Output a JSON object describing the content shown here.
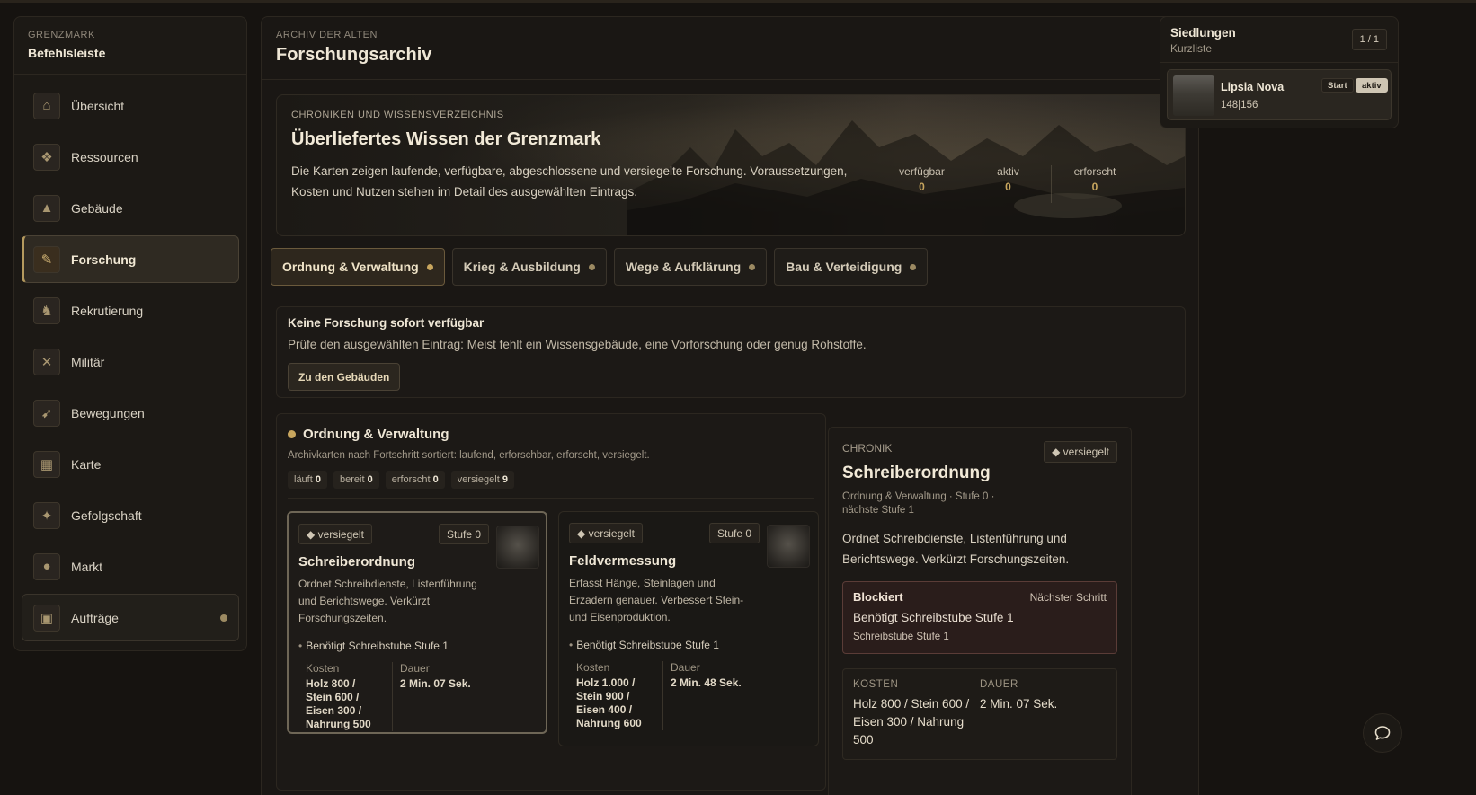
{
  "sidebar": {
    "eyebrow": "GRENZMARK",
    "title": "Befehlsleiste",
    "items": [
      {
        "label": "Übersicht",
        "icon": "overview-icon"
      },
      {
        "label": "Ressourcen",
        "icon": "resources-icon"
      },
      {
        "label": "Gebäude",
        "icon": "buildings-icon"
      },
      {
        "label": "Forschung",
        "icon": "research-icon"
      },
      {
        "label": "Rekrutierung",
        "icon": "recruitment-icon"
      },
      {
        "label": "Militär",
        "icon": "military-icon"
      },
      {
        "label": "Bewegungen",
        "icon": "movements-icon"
      },
      {
        "label": "Karte",
        "icon": "map-icon"
      },
      {
        "label": "Gefolgschaft",
        "icon": "following-icon"
      },
      {
        "label": "Markt",
        "icon": "market-icon"
      },
      {
        "label": "Aufträge",
        "icon": "orders-icon"
      }
    ]
  },
  "header": {
    "eyebrow": "ARCHIV DER ALTEN",
    "title": "Forschungsarchiv"
  },
  "hero": {
    "eyebrow": "CHRONIKEN UND WISSENSVERZEICHNIS",
    "title": "Überliefertes Wissen der Grenzmark",
    "description": "Die Karten zeigen laufende, verfügbare, abgeschlossene und versiegelte Forschung. Voraussetzungen, Kosten und Nutzen stehen im Detail des ausgewählten Eintrags.",
    "stats": [
      {
        "label": "verfügbar",
        "value": "0"
      },
      {
        "label": "aktiv",
        "value": "0"
      },
      {
        "label": "erforscht",
        "value": "0"
      }
    ]
  },
  "tabs": [
    {
      "label": "Ordnung & Verwaltung"
    },
    {
      "label": "Krieg & Ausbildung"
    },
    {
      "label": "Wege & Aufklärung"
    },
    {
      "label": "Bau & Verteidigung"
    }
  ],
  "notice": {
    "title": "Keine Forschung sofort verfügbar",
    "text": "Prüfe den ausgewählten Eintrag: Meist fehlt ein Wissensgebäude, eine Vorforschung oder genug Rohstoffe.",
    "button": "Zu den Gebäuden"
  },
  "section": {
    "title": "Ordnung & Verwaltung",
    "subtitle": "Archivkarten nach Fortschritt sortiert: laufend, erforschbar, erforscht, versiegelt.",
    "chips": [
      {
        "label": "läuft",
        "value": "0"
      },
      {
        "label": "bereit",
        "value": "0"
      },
      {
        "label": "erforscht",
        "value": "0"
      },
      {
        "label": "versiegelt",
        "value": "9"
      }
    ],
    "cards": [
      {
        "badge": "◆ versiegelt",
        "level": "Stufe 0",
        "title": "Schreiberordnung",
        "description": "Ordnet Schreibdienste, Listenführung und Berichtswege. Verkürzt Forschungszeiten.",
        "requirement": "Benötigt Schreibstube Stufe 1",
        "cost_label": "Kosten",
        "cost": "Holz 800 / Stein 600 / Eisen 300 / Nahrung 500",
        "duration_label": "Dauer",
        "duration": "2 Min. 07 Sek."
      },
      {
        "badge": "◆ versiegelt",
        "level": "Stufe 0",
        "title": "Feldvermessung",
        "description": "Erfasst Hänge, Steinlagen und Erzadern genauer. Verbessert Stein- und Eisenproduktion.",
        "requirement": "Benötigt Schreibstube Stufe 1",
        "cost_label": "Kosten",
        "cost": "Holz 1.000 / Stein 900 / Eisen 400 / Nahrung 600",
        "duration_label": "Dauer",
        "duration": "2 Min. 48 Sek."
      }
    ]
  },
  "detail": {
    "eyebrow": "CHRONIK",
    "badge": "◆ versiegelt",
    "title": "Schreiberordnung",
    "meta": "Ordnung & Verwaltung · Stufe 0 · nächste Stufe 1",
    "description": "Ordnet Schreibdienste, Listenführung und Berichtswege. Verkürzt Forschungszeiten.",
    "blocked_title": "Blockiert",
    "blocked_next": "Nächster Schritt",
    "blocked_requirement": "Benötigt Schreibstube Stufe 1",
    "blocked_sub": "Schreibstube Stufe 1",
    "cost_label": "KOSTEN",
    "cost": "Holz 800 / Stein 600 / Eisen 300 / Nahrung 500",
    "duration_label": "DAUER",
    "duration": "2 Min. 07 Sek."
  },
  "settlements": {
    "title": "Siedlungen",
    "subtitle": "Kurzliste",
    "count": "1 / 1",
    "items": [
      {
        "name": "Lipsia Nova",
        "stat": "148|156",
        "start": "Start",
        "status": "aktiv"
      }
    ]
  },
  "colors": {
    "accent": "#c8a65e",
    "background": "#161310",
    "blocked": "#2a1d1b"
  }
}
